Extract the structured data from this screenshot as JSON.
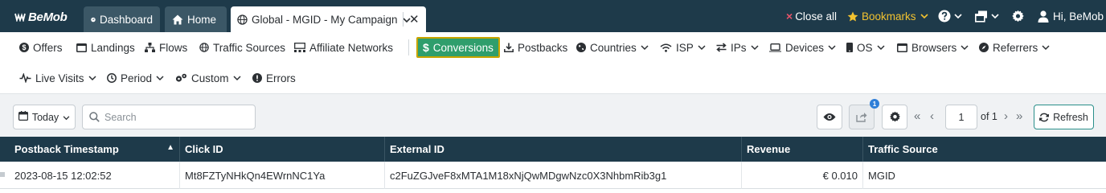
{
  "app": {
    "logo_text": "BeMob"
  },
  "tabs": [
    {
      "label": "Dashboard",
      "icon": "dashboard-icon"
    },
    {
      "label": "Home",
      "icon": "home-icon"
    },
    {
      "label": "Global - MGID - My Campaign",
      "icon": "globe-icon",
      "active": true
    }
  ],
  "topbar": {
    "close_all": "Close all",
    "bookmarks": "Bookmarks",
    "user_greeting": "Hi, BeMob"
  },
  "nav": {
    "offers": "Offers",
    "landings": "Landings",
    "flows": "Flows",
    "traffic_sources": "Traffic Sources",
    "affiliate_networks": "Affiliate Networks",
    "conversions": "Conversions",
    "postbacks": "Postbacks",
    "countries": "Countries",
    "isp": "ISP",
    "ips": "IPs",
    "devices": "Devices",
    "os": "OS",
    "browsers": "Browsers",
    "referrers": "Referrers",
    "live_visits": "Live Visits",
    "period": "Period",
    "custom": "Custom",
    "errors": "Errors"
  },
  "toolbar": {
    "date_range": "Today",
    "search_placeholder": "Search",
    "share_badge": "1",
    "page_value": "1",
    "of_pages": "of 1",
    "refresh": "Refresh"
  },
  "table": {
    "columns": [
      "Postback Timestamp",
      "Click ID",
      "External ID",
      "Revenue",
      "Traffic Source"
    ],
    "sorted_column": "Postback Timestamp",
    "sort_direction": "ascending",
    "rows": [
      [
        "2023-08-15 12:02:52",
        "Mt8FZTyNHkQn4EWrnNC1Ya",
        "c2FuZGJveF8xMTA1M18xNjQwMDgwNzc0X3NhbmRib3g1",
        "€ 0.010",
        "MGID"
      ]
    ]
  },
  "colors": {
    "topbar_bg": "#1e3a4a",
    "accent_green": "#2f9e6c",
    "bookmark_yellow": "#f2c230",
    "close_red": "#e8546a"
  }
}
